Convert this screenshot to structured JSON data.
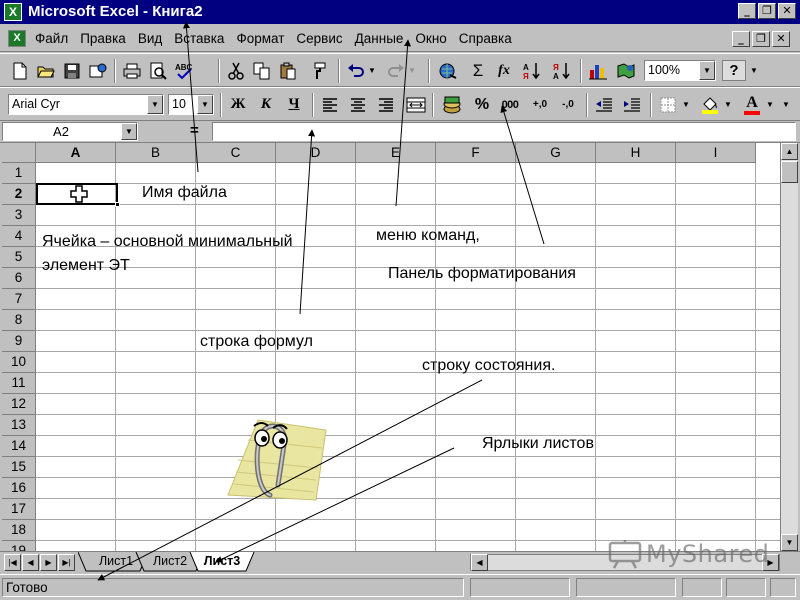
{
  "window": {
    "title": "Microsoft Excel - Книга2",
    "app_icon": "excel-icon",
    "buttons": [
      "minimize",
      "restore",
      "close"
    ]
  },
  "menu": {
    "items": [
      "Файл",
      "Правка",
      "Вид",
      "Вставка",
      "Формат",
      "Сервис",
      "Данные",
      "Окно",
      "Справка"
    ]
  },
  "toolbar_standard": {
    "icons": [
      "new-icon",
      "open-icon",
      "save-icon",
      "web-icon",
      "print-icon",
      "print-preview-icon",
      "spelling-icon",
      "cut-icon",
      "copy-icon",
      "paste-icon",
      "format-painter-icon",
      "undo-icon",
      "redo-icon",
      "hyperlink-icon",
      "autosum-icon",
      "function-icon",
      "sort-ascending-icon",
      "sort-descending-icon",
      "chart-wizard-icon",
      "map-icon",
      "help-icon"
    ],
    "autosum_glyph": "Σ",
    "function_glyph": "fx",
    "zoom": "100%",
    "help_glyph": "?"
  },
  "toolbar_formatting": {
    "font": "Arial Cyr",
    "size": "10",
    "bold": "Ж",
    "italic": "К",
    "underline": "Ч",
    "percent": "%",
    "thousands": "000",
    "inc_decimal": "+,0",
    "dec_decimal": "-,0",
    "font_color_glyph": "A",
    "fill_color": "#ffff00",
    "font_color": "#ff0000"
  },
  "formula_bar": {
    "name_box": "A2",
    "equals": "=",
    "formula": ""
  },
  "grid": {
    "columns": [
      "A",
      "B",
      "C",
      "D",
      "E",
      "F",
      "G",
      "H",
      "I"
    ],
    "rows": [
      "1",
      "2",
      "3",
      "4",
      "5",
      "6",
      "7",
      "8",
      "9",
      "10",
      "11",
      "12",
      "13",
      "14",
      "15",
      "16",
      "17",
      "18",
      "19"
    ],
    "active_column": "A",
    "active_row": "2"
  },
  "sheets": {
    "tabs": [
      "Лист1",
      "Лист2",
      "Лист3"
    ],
    "active": "Лист3"
  },
  "status": {
    "text": "Готово"
  },
  "annotations": {
    "file_name": "Имя файла",
    "cell_line1": "Ячейка – основной минимальный",
    "cell_line2": "элемент ЭТ",
    "menu_commands": "меню команд,",
    "format_panel": "Панель форматирования",
    "formula_line": "строка формул",
    "status_line": "строку состояния.",
    "sheet_tabs": "Ярлыки листов"
  },
  "watermark": {
    "text": "MyShared",
    "icon": "projector-icon"
  }
}
